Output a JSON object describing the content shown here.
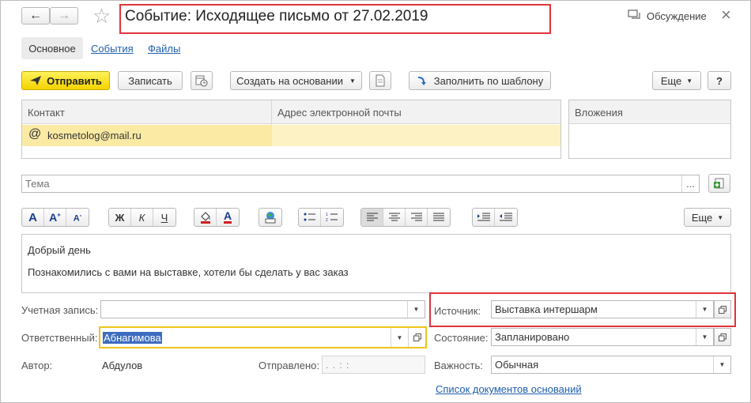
{
  "window": {
    "title": "Событие: Исходящее письмо от 27.02.2019",
    "discussion_label": "Обсуждение",
    "close_glyph": "×",
    "back_glyph": "←",
    "forward_glyph": "→",
    "star_glyph": "☆"
  },
  "tabs": [
    {
      "label": "Основное"
    },
    {
      "label": "События"
    },
    {
      "label": "Файлы"
    }
  ],
  "toolbar": {
    "send_label": "Отправить",
    "save_label": "Записать",
    "create_based_label": "Создать на основании",
    "fill_template_label": "Заполнить по шаблону",
    "more_label": "Еще",
    "help_label": "?"
  },
  "contacts_table": {
    "columns": [
      "Контакт",
      "Адрес электронной почты"
    ],
    "rows": [
      {
        "contact": "kosmetolog@mail.ru",
        "email": ""
      }
    ]
  },
  "attachments": {
    "header": "Вложения"
  },
  "subject": {
    "placeholder": "Тема",
    "value": "",
    "ellipsis": "..."
  },
  "format_toolbar": {
    "bold": "Ж",
    "italic": "К",
    "underline": "Ч",
    "font_a": "A",
    "more_label": "Еще"
  },
  "body": {
    "line1": "Добрый день",
    "line2": "Познакомились с вами на выставке, хотели бы сделать у вас заказ"
  },
  "form": {
    "account_label": "Учетная запись:",
    "account_value": "",
    "responsible_label": "Ответственный:",
    "responsible_value": "Абнагимова",
    "author_label": "Автор:",
    "author_value": "Абдулов",
    "sent_label": "Отправлено:",
    "sent_value": " .  .      :  :",
    "source_label": "Источник:",
    "source_value": "Выставка интершарм",
    "state_label": "Состояние:",
    "state_value": "Запланировано",
    "importance_label": "Важность:",
    "importance_value": "Обычная",
    "documents_link": "Список документов оснований"
  },
  "colors": {
    "accent_yellow": "#f3d300",
    "highlight_box": "#e0333c",
    "row_selected": "#fbeaa4",
    "link": "#1f5fae"
  }
}
